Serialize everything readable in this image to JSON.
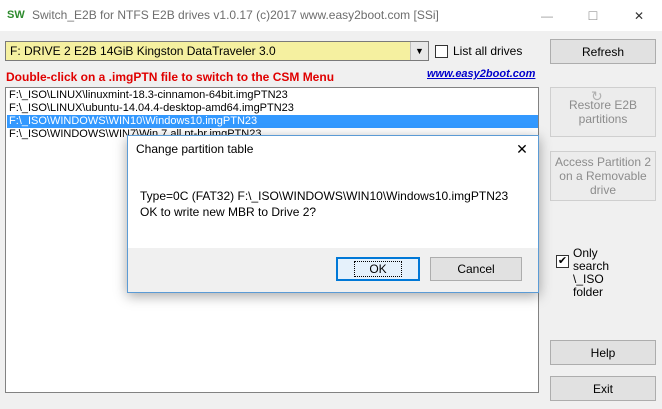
{
  "window": {
    "icon_text": "SW",
    "title": "Switch_E2B  for NTFS E2B drives    v1.0.17  (c)2017 www.easy2boot.com [SSi]",
    "controls": {
      "minimize": "—",
      "maximize": "☐",
      "close": "✕"
    }
  },
  "drive_select": {
    "value": "F: DRIVE 2  E2B      14GiB Kingston DataTraveler 3.0",
    "arrow": "▼"
  },
  "list_all": {
    "label": "List all drives",
    "checked": false
  },
  "hint": "Double-click on a .imgPTN file to switch to the CSM Menu",
  "link": "www.easy2boot.com",
  "files": [
    "F:\\_ISO\\LINUX\\linuxmint-18.3-cinnamon-64bit.imgPTN23",
    "F:\\_ISO\\LINUX\\ubuntu-14.04.4-desktop-amd64.imgPTN23",
    "F:\\_ISO\\WINDOWS\\WIN10\\Windows10.imgPTN23",
    "F:\\_ISO\\WINDOWS\\WIN7\\Win 7 all pt-br.imgPTN23"
  ],
  "selected_index": 2,
  "buttons": {
    "refresh": "Refresh",
    "restore": "Restore E2B partitions",
    "restore_icon": "↻",
    "access": "Access Partition 2 on a Removable drive",
    "help": "Help",
    "exit": "Exit"
  },
  "only_search": {
    "label": "Only search \\_ISO folder",
    "checked": true,
    "mark": "✔"
  },
  "dialog": {
    "title": "Change partition table",
    "close": "✕",
    "line1": "Type=0C (FAT32)  F:\\_ISO\\WINDOWS\\WIN10\\Windows10.imgPTN23",
    "line2": "OK to write new MBR to Drive 2?",
    "ok": "OK",
    "cancel": "Cancel"
  }
}
